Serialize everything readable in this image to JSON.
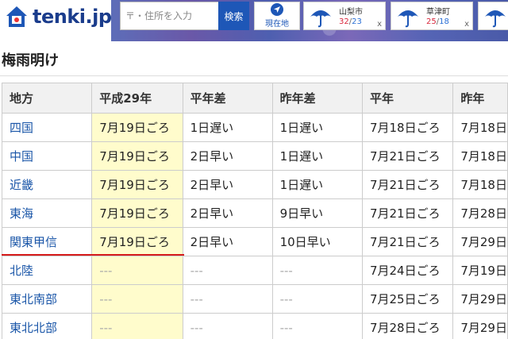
{
  "header": {
    "logo_text": "tenki.jp",
    "search_placeholder": "〒・住所を入力",
    "search_button": "検索",
    "location_button": "現在地",
    "weather_cards": [
      {
        "city": "山梨市",
        "high": "32",
        "low": "23",
        "close": "x"
      },
      {
        "city": "草津町",
        "high": "25",
        "low": "18",
        "close": "x"
      },
      {
        "city": "",
        "high": "",
        "low": "",
        "close": ""
      }
    ],
    "temp_sep": "/"
  },
  "page_title": "梅雨明け",
  "table": {
    "headers": [
      "地方",
      "平成29年",
      "平年差",
      "昨年差",
      "平年",
      "昨年"
    ],
    "rows": [
      [
        "四国",
        "7月19日ごろ",
        "1日遅い",
        "1日遅い",
        "7月18日ごろ",
        "7月18日"
      ],
      [
        "中国",
        "7月19日ごろ",
        "2日早い",
        "1日遅い",
        "7月21日ごろ",
        "7月18日"
      ],
      [
        "近畿",
        "7月19日ごろ",
        "2日早い",
        "1日遅い",
        "7月21日ごろ",
        "7月18日"
      ],
      [
        "東海",
        "7月19日ごろ",
        "2日早い",
        "9日早い",
        "7月21日ごろ",
        "7月28日"
      ],
      [
        "関東甲信",
        "7月19日ごろ",
        "2日早い",
        "10日早い",
        "7月21日ごろ",
        "7月29日"
      ],
      [
        "北陸",
        "---",
        "---",
        "---",
        "7月24日ごろ",
        "7月19日"
      ],
      [
        "東北南部",
        "---",
        "---",
        "---",
        "7月25日ごろ",
        "7月29日"
      ],
      [
        "東北北部",
        "---",
        "---",
        "---",
        "7月28日ごろ",
        "7月29日"
      ]
    ]
  },
  "colors": {
    "brand": "#1e57b7",
    "highlight": "#fffccc",
    "link": "#1a56a8",
    "underline": "#d51b1b"
  }
}
